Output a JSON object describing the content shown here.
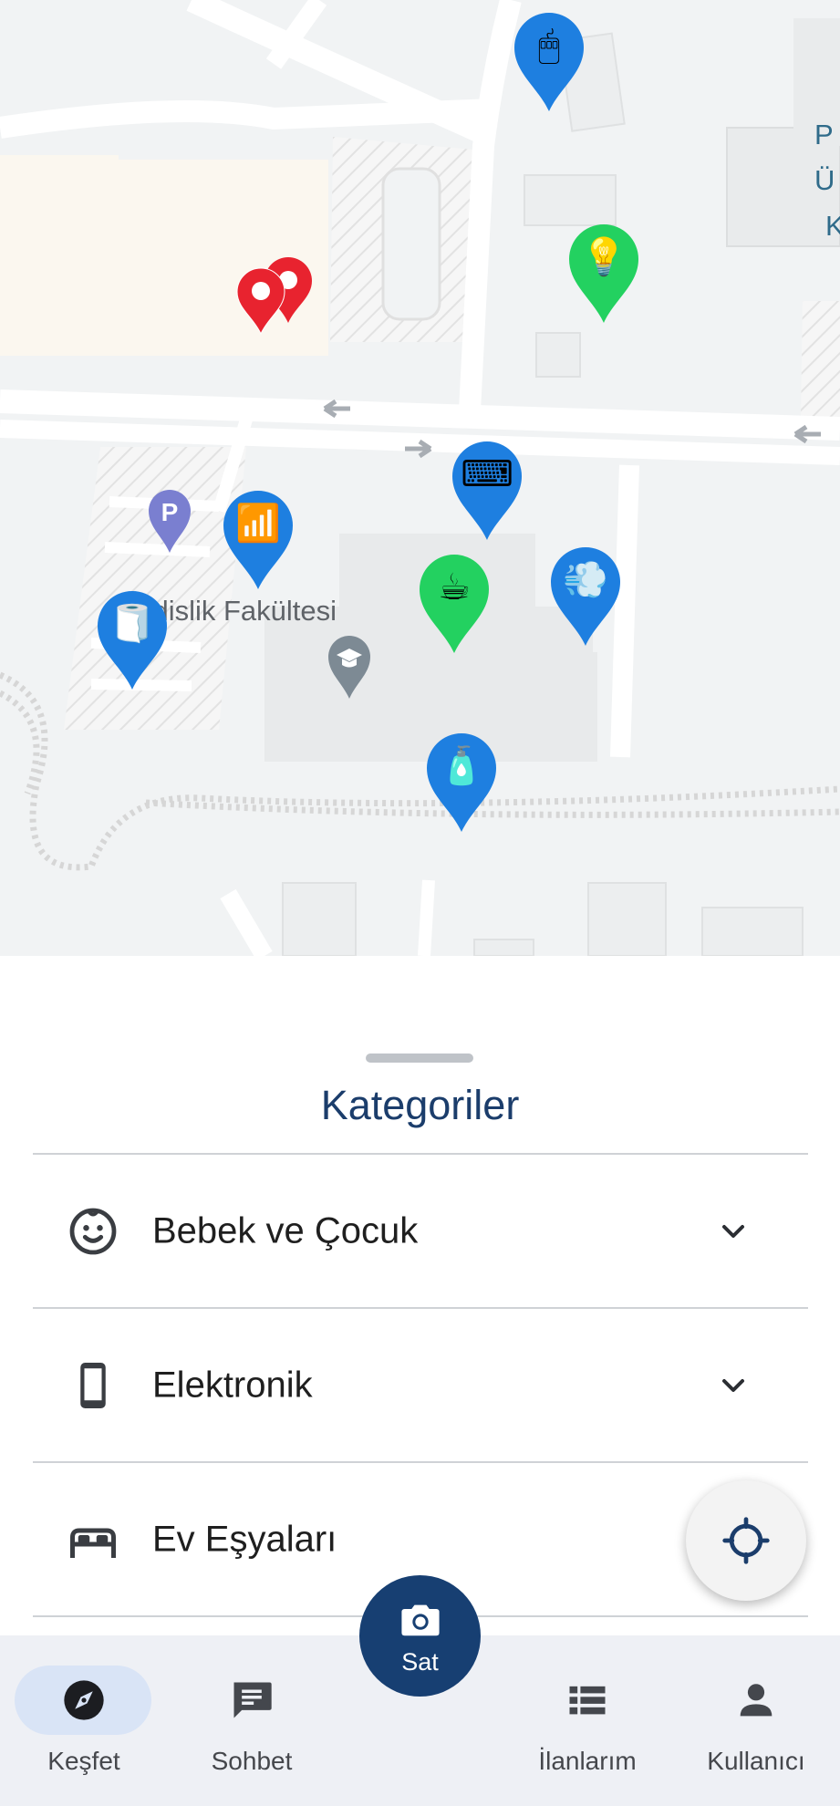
{
  "map": {
    "faculty_label": "endislik Fakültesi",
    "edge_label_lines": [
      "P",
      "Ü",
      "K"
    ],
    "markers": [
      {
        "name": "mouse-marker",
        "color": "#1e7fe0",
        "emoji": "🖱"
      },
      {
        "name": "lightbulb-marker",
        "color": "#23d160",
        "emoji": "💡"
      },
      {
        "name": "red-cluster-marker",
        "color": "#e8232f",
        "emoji": ""
      },
      {
        "name": "keyboard-marker",
        "color": "#1e7fe0",
        "emoji": "⌨"
      },
      {
        "name": "signal-marker",
        "color": "#1e7fe0",
        "emoji": "📶"
      },
      {
        "name": "coffee-marker",
        "color": "#23d160",
        "emoji": "☕"
      },
      {
        "name": "hairdryer-marker",
        "color": "#1e7fe0",
        "emoji": "💨"
      },
      {
        "name": "toilet-paper-marker",
        "color": "#1e7fe0",
        "emoji": "🧻"
      },
      {
        "name": "lotion-marker",
        "color": "#1e7fe0",
        "emoji": "🧴"
      }
    ]
  },
  "sheet": {
    "title": "Kategoriler",
    "categories": [
      {
        "label": "Bebek ve Çocuk",
        "icon": "baby-face-icon",
        "expandable": true
      },
      {
        "label": "Elektronik",
        "icon": "smartphone-icon",
        "expandable": true
      },
      {
        "label": "Ev Eşyaları",
        "icon": "bed-icon",
        "expandable": false
      }
    ]
  },
  "fab": {
    "icon": "my-location-icon"
  },
  "sell": {
    "label": "Sat",
    "icon": "camera-icon"
  },
  "nav": {
    "items": [
      {
        "label": "Keşfet",
        "icon": "compass-icon",
        "active": true
      },
      {
        "label": "Sohbet",
        "icon": "chat-icon",
        "active": false
      },
      {
        "label": "İlanlarım",
        "icon": "list-icon",
        "active": false
      },
      {
        "label": "Kullanıcı",
        "icon": "person-icon",
        "active": false
      }
    ],
    "active_color": "#d9e4f6"
  }
}
